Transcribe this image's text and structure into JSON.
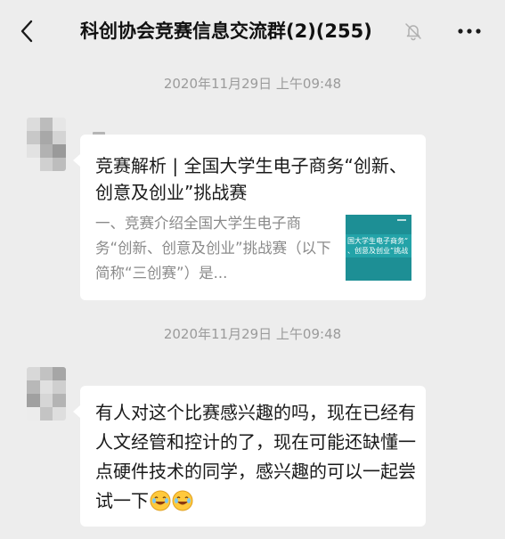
{
  "header": {
    "title": "科创协会竞赛信息交流群(2)(255)",
    "back_icon": "chevron-left-icon",
    "mute_icon": "bell-off-icon",
    "more_icon": "more-horizontal-icon"
  },
  "messages": [
    {
      "timestamp": "2020年11月29日 上午09:48",
      "type": "link-card",
      "card": {
        "title": "竞赛解析 | 全国大学生电子商务“创新、创意及创业”挑战赛",
        "description": "一、竞赛介绍全国大学生电子商务“创新、创意及创业”挑战赛（以下简称“三创赛”）是...",
        "thumbnail_text_line1": "国大学生电子商务“",
        "thumbnail_text_line2": "、创意及创业”挑战",
        "thumbnail_color": "#1d8f95"
      }
    },
    {
      "timestamp": "2020年11月29日 上午09:48",
      "type": "text",
      "text": "有人对这个比赛感兴趣的吗，现在已经有人文经管和控计的了，现在可能还缺懂一点硬件技术的同学，感兴趣的可以一起尝试一下",
      "emojis": [
        "laughing-face-icon",
        "laughing-face-icon"
      ]
    }
  ],
  "colors": {
    "background": "#ededed",
    "bubble": "#ffffff",
    "timestamp": "#9b9b9b"
  }
}
